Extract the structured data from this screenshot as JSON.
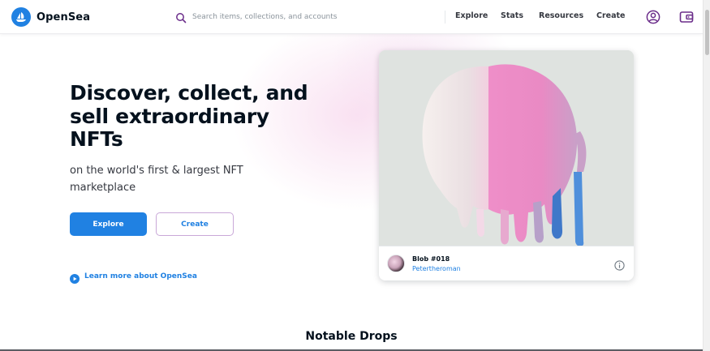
{
  "brand": {
    "name": "OpenSea",
    "accent_color": "#2081e2",
    "logo_icon": "sailboat-logo-icon"
  },
  "search": {
    "placeholder": "Search items, collections, and accounts",
    "value": "",
    "icon": "search-icon"
  },
  "nav": {
    "items": [
      {
        "label": "Explore"
      },
      {
        "label": "Stats"
      },
      {
        "label": "Resources"
      },
      {
        "label": "Create"
      }
    ],
    "account_icon": "account-icon",
    "wallet_icon": "wallet-icon"
  },
  "hero": {
    "title": "Discover, collect, and sell extraordinary NFTs",
    "subtitle": "on the world's first & largest NFT marketplace",
    "explore_label": "Explore",
    "create_label": "Create",
    "learn_more_label": "Learn more about OpenSea",
    "learn_more_icon": "play-circle-icon"
  },
  "featured": {
    "nft_name": "Blob #018",
    "creator": "Petertheroman",
    "info_icon": "info-icon"
  },
  "section": {
    "title": "Notable Drops"
  }
}
